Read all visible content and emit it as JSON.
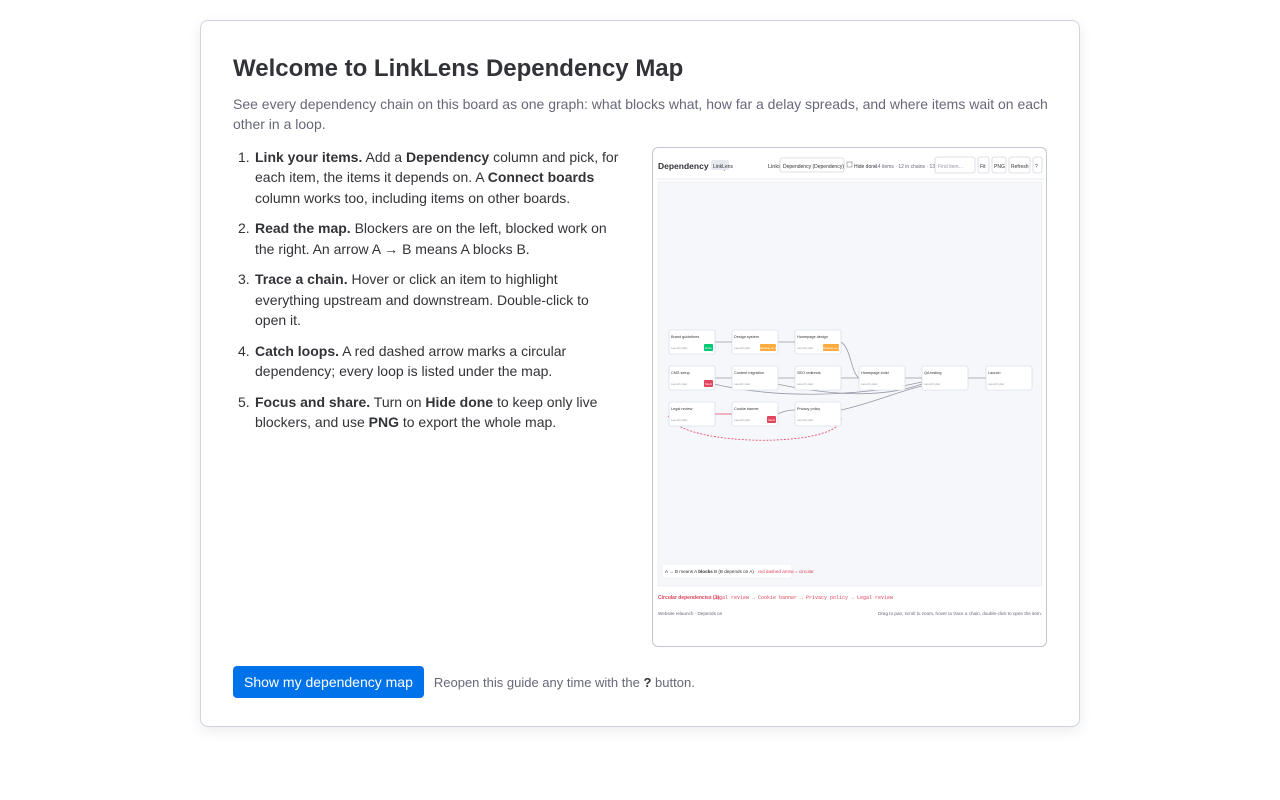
{
  "dialog": {
    "title": "Welcome to LinkLens Dependency Map",
    "subtitle": "See every dependency chain on this board as one graph: what blocks what, how far a delay spreads, and where items wait on each other in a loop."
  },
  "steps": [
    {
      "num": "1.",
      "bold1": "Link your items.",
      "t1": " Add a ",
      "bold2": "Dependency",
      "t2": " column and pick, for each item, the items it depends on. A ",
      "bold3": "Connect boards",
      "t3": " column works too, including items on other boards."
    },
    {
      "num": "2.",
      "bold1": "Read the map.",
      "t1": " Blockers are on the left, blocked work on the right. An arrow A → B means A blocks B."
    },
    {
      "num": "3.",
      "bold1": "Trace a chain.",
      "t1": " Hover or click an item to highlight everything upstream and downstream. Double-click to open it."
    },
    {
      "num": "4.",
      "bold1": "Catch loops.",
      "t1": " A red dashed arrow marks a circular dependency; every loop is listed under the map."
    },
    {
      "num": "5.",
      "bold1": "Focus and share.",
      "t1": " Turn on ",
      "bold2": "Hide done",
      "t2": " to keep only live blockers, and use ",
      "bold3": "PNG",
      "t3": " to export the whole map."
    }
  ],
  "preview": {
    "title": "Dependency map",
    "badge": "LinkLens",
    "links_label": "Links",
    "links_select": "Dependency (Dependency)",
    "hide_done": "Hide done",
    "stats": "14 items · 12 in chains · 13 links",
    "find_placeholder": "Find item…",
    "fit": "Fit",
    "png": "PNG",
    "refresh": "Refresh",
    "help": "?",
    "legend_a": "A → B means A",
    "legend_blocks": "blocks",
    "legend_b": "B (B depends on A) ·",
    "legend_red": "red dashed arrow = circular",
    "circular_label": "Circular dependencies (1):",
    "circular_chain": "Legal review → Cookie banner → Privacy policy → Legal review",
    "footer_left": "Website relaunch · Depends on",
    "footer_right": "Drag to pan, scroll to zoom, hover to trace a chain, double-click to open the item.",
    "nodes": [
      {
        "name": "Brand guidelines",
        "sub": "Launch plan",
        "status": "Done"
      },
      {
        "name": "Design system",
        "sub": "Launch plan",
        "status": "Working on it"
      },
      {
        "name": "Homepage design",
        "sub": "Launch plan",
        "status": "Working on it"
      },
      {
        "name": "CMS setup",
        "sub": "Launch plan",
        "status": "Stuck"
      },
      {
        "name": "Content migration",
        "sub": "Launch plan",
        "status": ""
      },
      {
        "name": "SEO redirects",
        "sub": "Launch plan",
        "status": ""
      },
      {
        "name": "Homepage build",
        "sub": "Launch plan",
        "status": ""
      },
      {
        "name": "QA testing",
        "sub": "Launch plan",
        "status": ""
      },
      {
        "name": "Launch",
        "sub": "Launch plan",
        "status": ""
      },
      {
        "name": "Legal review",
        "sub": "Launch plan",
        "status": ""
      },
      {
        "name": "Cookie banner",
        "sub": "Launch plan",
        "status": "Stuck"
      },
      {
        "name": "Privacy policy",
        "sub": "Launch plan",
        "status": ""
      }
    ],
    "colors": {
      "done": "#00c875",
      "working": "#fdab3d",
      "stuck": "#e2445c",
      "loop": "#e2445c"
    }
  },
  "footer": {
    "primary_button": "Show my dependency map",
    "hint_pre": "Reopen this guide any time with the",
    "hint_key": "?",
    "hint_post": "button."
  }
}
